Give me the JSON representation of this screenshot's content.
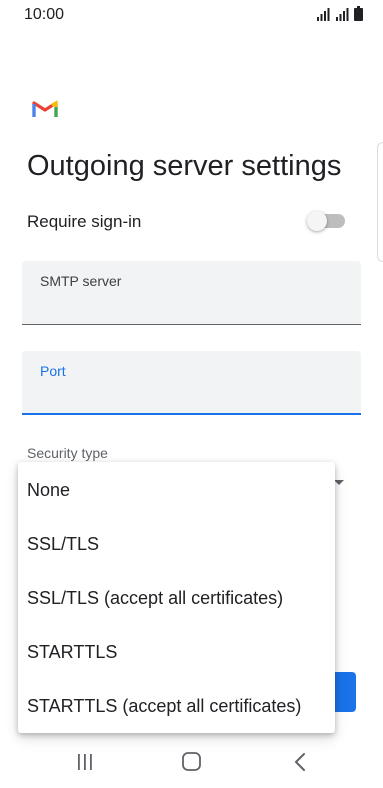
{
  "status_bar": {
    "time": "10:00",
    "icons": [
      "wifi-icon",
      "signal-icon",
      "battery-icon"
    ]
  },
  "app": {
    "logo": "gmail-logo-icon"
  },
  "page": {
    "title": "Outgoing server settings"
  },
  "require_signin": {
    "label": "Require sign-in",
    "enabled": false
  },
  "fields": {
    "smtp_server": {
      "label": "SMTP server",
      "value": ""
    },
    "port": {
      "label": "Port",
      "value": ""
    }
  },
  "security_type": {
    "label": "Security type",
    "options": [
      "None",
      "SSL/TLS",
      "SSL/TLS (accept all certificates)",
      "STARTTLS",
      "STARTTLS (accept all certificates)"
    ]
  },
  "nav_bar": {
    "icons": [
      "recents-icon",
      "home-icon",
      "back-icon"
    ]
  },
  "colors": {
    "accent": "#1a73e8",
    "field_background": "#f1f3f4",
    "text": "#202124"
  }
}
